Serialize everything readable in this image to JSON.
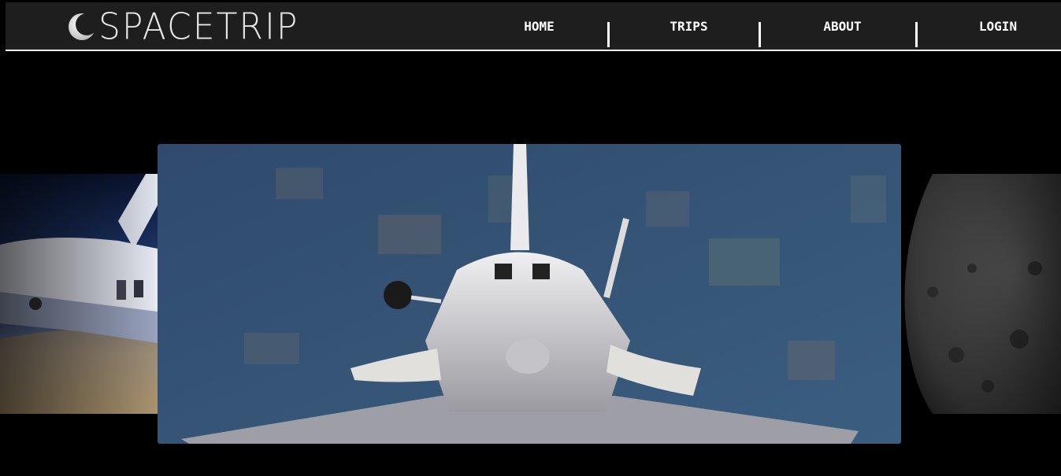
{
  "brand": {
    "name": "SPACETRIP"
  },
  "nav": {
    "items": [
      {
        "label": "HOME"
      },
      {
        "label": "TRIPS"
      },
      {
        "label": "ABOUT"
      },
      {
        "label": "LOGIN"
      }
    ]
  },
  "carousel": {
    "slides": [
      {
        "subject": "space-shuttle-side-over-clouds"
      },
      {
        "subject": "space-shuttle-rear-over-earth"
      },
      {
        "subject": "moon-surface"
      }
    ]
  },
  "colors": {
    "header_bg": "#1e1e1e",
    "page_bg": "#000000",
    "text": "#ffffff",
    "earth_blue": "#3a5577"
  }
}
